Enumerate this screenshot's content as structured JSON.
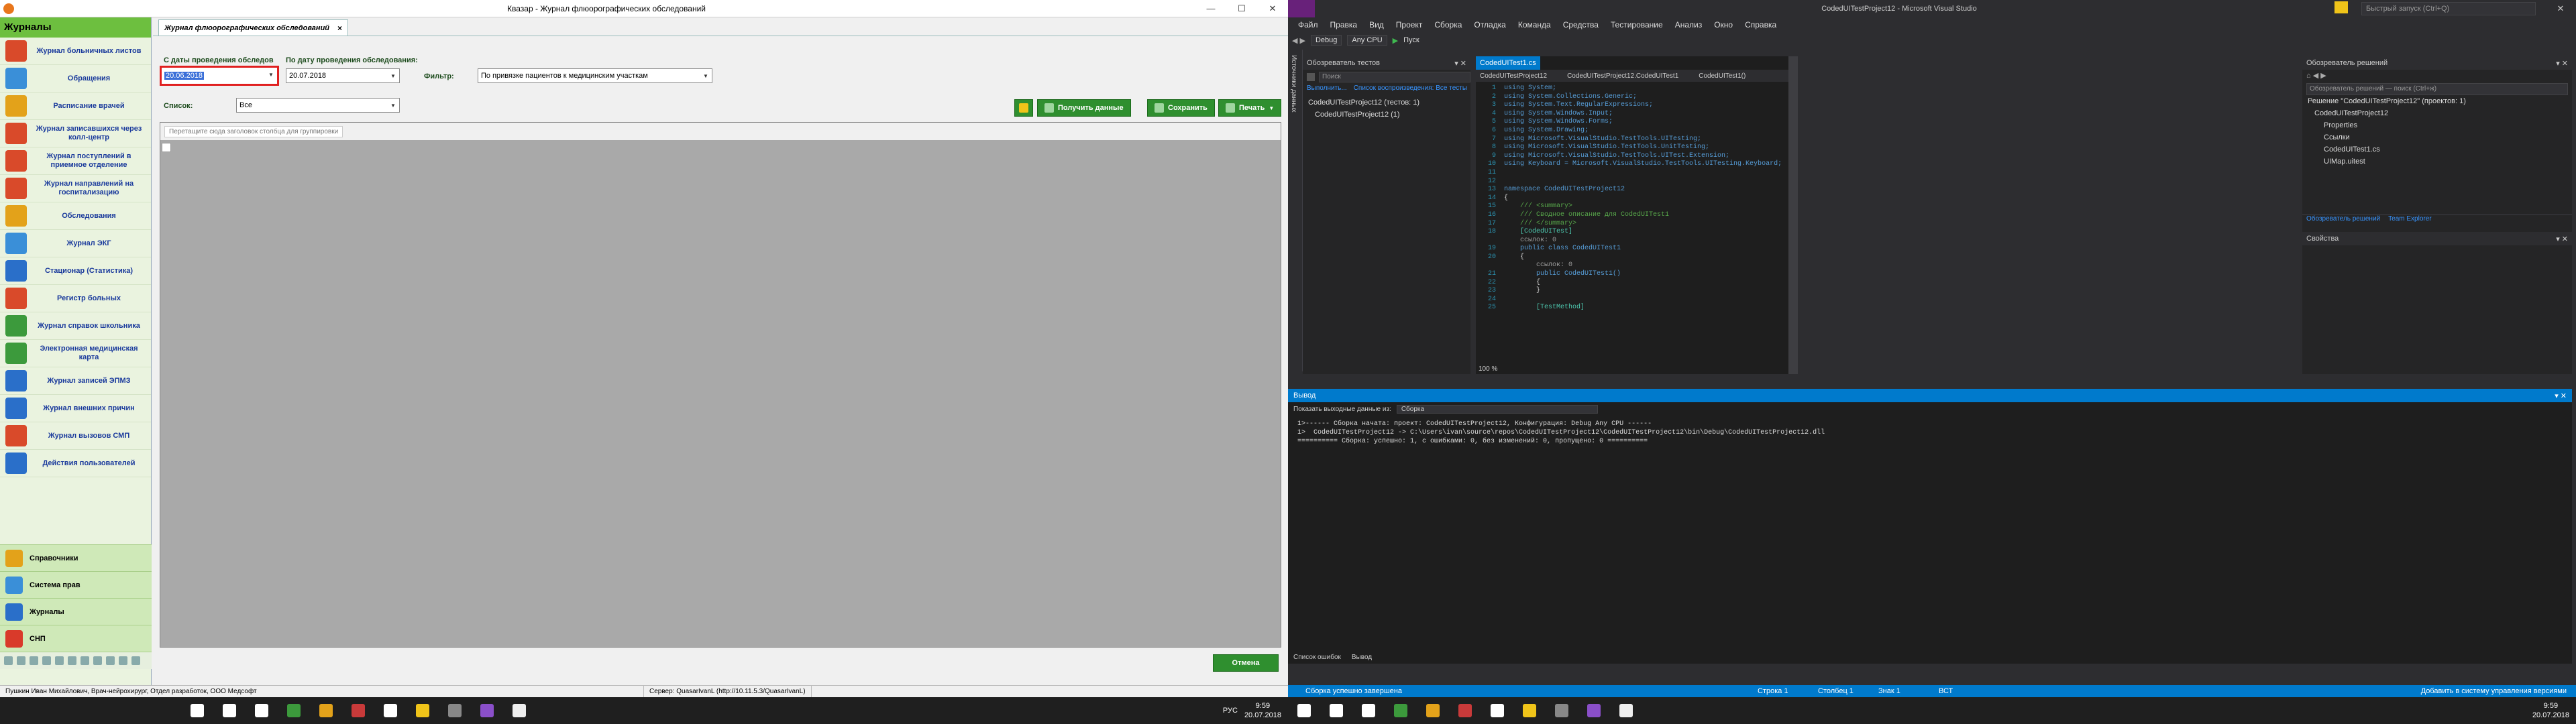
{
  "left": {
    "window_title": "Квазар - Журнал флюорографических обследований",
    "nav_header": "Журналы",
    "nav_items": [
      {
        "label": "Журнал больничных листов",
        "color": "#d94a2a"
      },
      {
        "label": "Обращения",
        "color": "#3a8fd8"
      },
      {
        "label": "Расписание врачей",
        "color": "#e3a21a"
      },
      {
        "label": "Журнал записавшихся через колл-центр",
        "color": "#d94a2a"
      },
      {
        "label": "Журнал поступлений в приемное отделение",
        "color": "#d94a2a"
      },
      {
        "label": "Журнал направлений на госпитализацию",
        "color": "#d94a2a"
      },
      {
        "label": "Обследования",
        "color": "#e3a21a"
      },
      {
        "label": "Журнал ЭКГ",
        "color": "#3a8fd8"
      },
      {
        "label": "Стационар (Статистика)",
        "color": "#2a6fc9"
      },
      {
        "label": "Регистр больных",
        "color": "#d94a2a"
      },
      {
        "label": "Журнал справок школьника",
        "color": "#3c9a3c"
      },
      {
        "label": "Электронная медицинская карта",
        "color": "#3c9a3c"
      },
      {
        "label": "Журнал записей ЭПМЗ",
        "color": "#2a6fc9"
      },
      {
        "label": "Журнал внешних причин",
        "color": "#2a6fc9"
      },
      {
        "label": "Журнал вызовов СМП",
        "color": "#d94a2a"
      },
      {
        "label": "Действия пользователей",
        "color": "#2a6fc9"
      }
    ],
    "bottom_nav": [
      {
        "label": "Справочники",
        "color": "#e3a21a"
      },
      {
        "label": "Система прав",
        "color": "#3a8fd8"
      },
      {
        "label": "Журналы",
        "color": "#2a6fc9"
      },
      {
        "label": "СНП",
        "color": "#d93a2a"
      }
    ],
    "tab_label": "Журнал флюорографических обследований",
    "tab_close": "×",
    "date_from_label": "С даты проведения обследов",
    "date_to_label": "По дату проведения обследования:",
    "date_from_value": "20.06.2018",
    "date_to_value": "20.07.2018",
    "filter_label": "Фильтр:",
    "filter_value": "По привязке пациентов к медицинским участкам",
    "list_label": "Список:",
    "list_value": "Все",
    "btn_get": "Получить данные",
    "btn_save": "Сохранить",
    "btn_print": "Печать",
    "group_hint": "Перетащите сюда заголовок столбца для группировки",
    "btn_cancel": "Отмена",
    "status_user": "Пушкин Иван Михайлович, Врач-нейрохирург, Отдел разработок, ООО Медсофт",
    "status_server": "Сервер: QuasarIvanL (http://10.11.5.3/QuasarIvanL)",
    "clock_time": "9:59",
    "clock_date": "20.07.2018",
    "lang": "РУС",
    "taskbar_icons": [
      {
        "name": "start-icon",
        "color": "#ffffff"
      },
      {
        "name": "search-icon",
        "color": "#ffffff"
      },
      {
        "name": "taskview-icon",
        "color": "#ffffff"
      },
      {
        "name": "app-green-icon",
        "color": "#3c9a3c"
      },
      {
        "name": "app-quasar-icon",
        "color": "#e3a21a"
      },
      {
        "name": "app-tools-icon",
        "color": "#c93a3a"
      },
      {
        "name": "app-clock-icon",
        "color": "#ffffff"
      },
      {
        "name": "chrome-icon",
        "color": "#f0c419"
      },
      {
        "name": "app-gray-icon",
        "color": "#888888"
      },
      {
        "name": "visual-studio-icon",
        "color": "#8a4fc9"
      },
      {
        "name": "app-white-icon",
        "color": "#eeeeee"
      }
    ]
  },
  "right": {
    "window_title": "CodedUITestProject12 - Microsoft Visual Studio",
    "quick_launch": "Быстрый запуск (Ctrl+Q)",
    "menu": [
      "Файл",
      "Правка",
      "Вид",
      "Проект",
      "Сборка",
      "Отладка",
      "Команда",
      "Средства",
      "Тестирование",
      "Анализ",
      "Окно",
      "Справка"
    ],
    "toolbar": {
      "config": "Debug",
      "platform": "Any CPU",
      "run": "Пуск"
    },
    "test_explorer_title": "Обозреватель тестов",
    "test_search": "Поиск",
    "test_group": "Список воспроизведения: Все тесты",
    "test_run": "Выполнить...",
    "test_project": "CodedUITestProject12 (тестов: 1)",
    "test_item": "CodedUITestProject12 (1)",
    "side_label": "Источники данных",
    "editor_tab": "CodedUITest1.cs",
    "editor_nav": [
      "CodedUITestProject12",
      "CodedUITestProject12.CodedUITest1",
      "CodedUITest1()"
    ],
    "code_lines": [
      {
        "n": "1",
        "t": "using System;"
      },
      {
        "n": "2",
        "t": "using System.Collections.Generic;"
      },
      {
        "n": "3",
        "t": "using System.Text.RegularExpressions;"
      },
      {
        "n": "4",
        "t": "using System.Windows.Input;"
      },
      {
        "n": "5",
        "t": "using System.Windows.Forms;"
      },
      {
        "n": "6",
        "t": "using System.Drawing;"
      },
      {
        "n": "7",
        "t": "using Microsoft.VisualStudio.TestTools.UITesting;"
      },
      {
        "n": "8",
        "t": "using Microsoft.VisualStudio.TestTools.UnitTesting;"
      },
      {
        "n": "9",
        "t": "using Microsoft.VisualStudio.TestTools.UITest.Extension;"
      },
      {
        "n": "10",
        "t": "using Keyboard = Microsoft.VisualStudio.TestTools.UITesting.Keyboard;"
      },
      {
        "n": "11",
        "t": ""
      },
      {
        "n": "12",
        "t": ""
      },
      {
        "n": "13",
        "t": "namespace CodedUITestProject12"
      },
      {
        "n": "14",
        "t": "{"
      },
      {
        "n": "15",
        "t": "    /// <summary>"
      },
      {
        "n": "16",
        "t": "    /// Сводное описание для CodedUITest1"
      },
      {
        "n": "17",
        "t": "    /// </summary>"
      },
      {
        "n": "18",
        "t": "    [CodedUITest]"
      },
      {
        "n": "",
        "t": "    ссылок: 0"
      },
      {
        "n": "19",
        "t": "    public class CodedUITest1"
      },
      {
        "n": "20",
        "t": "    {"
      },
      {
        "n": "",
        "t": "        ссылок: 0"
      },
      {
        "n": "21",
        "t": "        public CodedUITest1()"
      },
      {
        "n": "22",
        "t": "        {"
      },
      {
        "n": "23",
        "t": "        }"
      },
      {
        "n": "24",
        "t": ""
      },
      {
        "n": "25",
        "t": "        [TestMethod]"
      }
    ],
    "zoom": "100 %",
    "sol_title": "Обозреватель решений",
    "sol_search": "Обозреватель решений — поиск (Ctrl+ж)",
    "sol_items": [
      "Решение \"CodedUITestProject12\" (проектов: 1)",
      "CodedUITestProject12",
      "Properties",
      "Ссылки",
      "CodedUITest1.cs",
      "UIMap.uitest"
    ],
    "sol_tabs": [
      "Обозреватель решений",
      "Team Explorer"
    ],
    "props_title": "Свойства",
    "output_title": "Вывод",
    "output_source_label": "Показать выходные данные из:",
    "output_source": "Сборка",
    "output_lines": [
      "1>------ Сборка начата: проект: CodedUITestProject12, Конфигурация: Debug Any CPU ------",
      "1>  CodedUITestProject12 -> C:\\Users\\ivan\\source\\repos\\CodedUITestProject12\\CodedUITestProject12\\bin\\Debug\\CodedUITestProject12.dll",
      "========== Сборка: успешно: 1, с ошибками: 0, без изменений: 0, пропущено: 0 =========="
    ],
    "bottom_tabs": [
      "Список ошибок",
      "Вывод"
    ],
    "status_msg": "Сборка успешно завершена",
    "status_line": "Строка 1",
    "status_col": "Столбец 1",
    "status_char": "Знак 1",
    "status_mode": "ВСТ",
    "status_vcs": "Добавить в систему управления версиями",
    "clock_time": "9:59",
    "clock_date": "20.07.2018"
  }
}
